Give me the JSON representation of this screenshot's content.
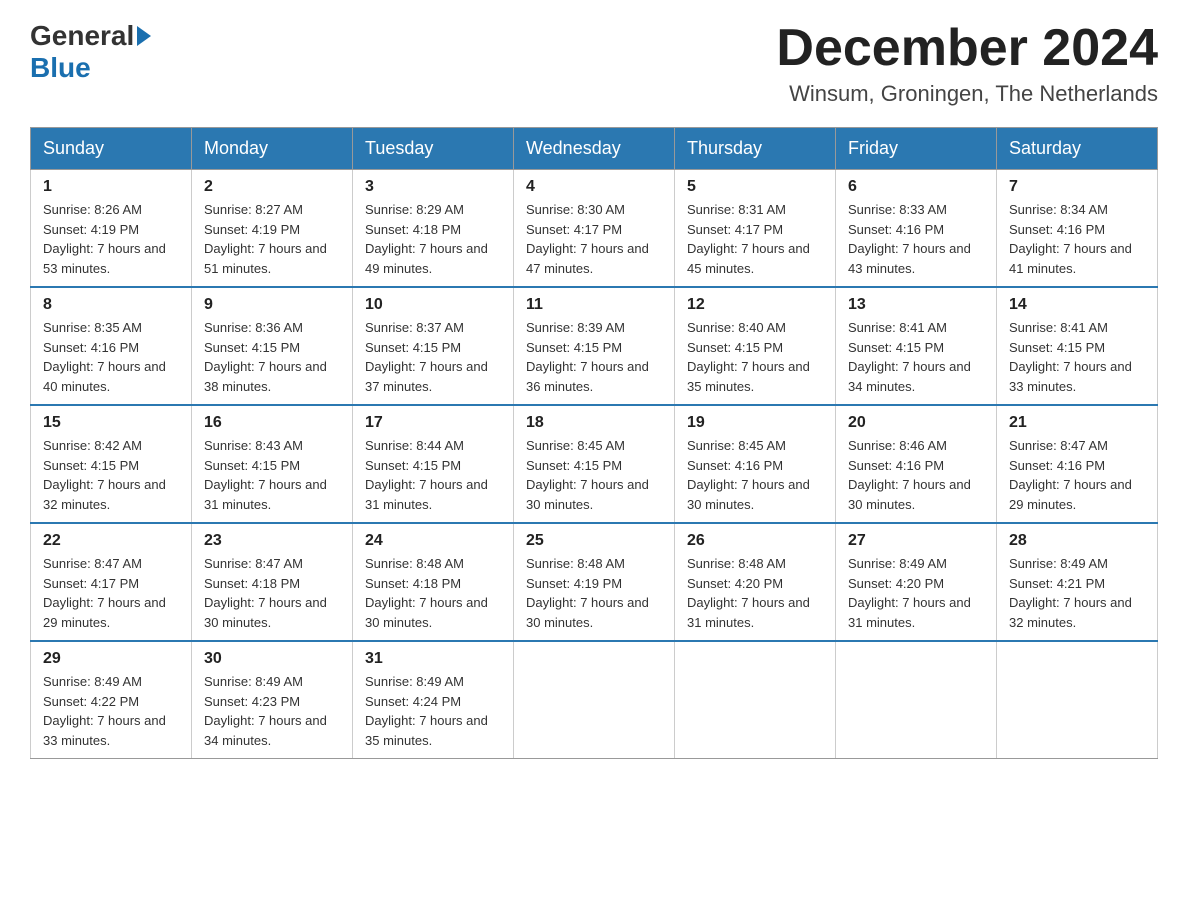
{
  "header": {
    "logo_general": "General",
    "logo_blue": "Blue",
    "month_title": "December 2024",
    "location": "Winsum, Groningen, The Netherlands"
  },
  "weekdays": [
    "Sunday",
    "Monday",
    "Tuesday",
    "Wednesday",
    "Thursday",
    "Friday",
    "Saturday"
  ],
  "weeks": [
    [
      {
        "day": "1",
        "sunrise": "8:26 AM",
        "sunset": "4:19 PM",
        "daylight": "7 hours and 53 minutes."
      },
      {
        "day": "2",
        "sunrise": "8:27 AM",
        "sunset": "4:19 PM",
        "daylight": "7 hours and 51 minutes."
      },
      {
        "day": "3",
        "sunrise": "8:29 AM",
        "sunset": "4:18 PM",
        "daylight": "7 hours and 49 minutes."
      },
      {
        "day": "4",
        "sunrise": "8:30 AM",
        "sunset": "4:17 PM",
        "daylight": "7 hours and 47 minutes."
      },
      {
        "day": "5",
        "sunrise": "8:31 AM",
        "sunset": "4:17 PM",
        "daylight": "7 hours and 45 minutes."
      },
      {
        "day": "6",
        "sunrise": "8:33 AM",
        "sunset": "4:16 PM",
        "daylight": "7 hours and 43 minutes."
      },
      {
        "day": "7",
        "sunrise": "8:34 AM",
        "sunset": "4:16 PM",
        "daylight": "7 hours and 41 minutes."
      }
    ],
    [
      {
        "day": "8",
        "sunrise": "8:35 AM",
        "sunset": "4:16 PM",
        "daylight": "7 hours and 40 minutes."
      },
      {
        "day": "9",
        "sunrise": "8:36 AM",
        "sunset": "4:15 PM",
        "daylight": "7 hours and 38 minutes."
      },
      {
        "day": "10",
        "sunrise": "8:37 AM",
        "sunset": "4:15 PM",
        "daylight": "7 hours and 37 minutes."
      },
      {
        "day": "11",
        "sunrise": "8:39 AM",
        "sunset": "4:15 PM",
        "daylight": "7 hours and 36 minutes."
      },
      {
        "day": "12",
        "sunrise": "8:40 AM",
        "sunset": "4:15 PM",
        "daylight": "7 hours and 35 minutes."
      },
      {
        "day": "13",
        "sunrise": "8:41 AM",
        "sunset": "4:15 PM",
        "daylight": "7 hours and 34 minutes."
      },
      {
        "day": "14",
        "sunrise": "8:41 AM",
        "sunset": "4:15 PM",
        "daylight": "7 hours and 33 minutes."
      }
    ],
    [
      {
        "day": "15",
        "sunrise": "8:42 AM",
        "sunset": "4:15 PM",
        "daylight": "7 hours and 32 minutes."
      },
      {
        "day": "16",
        "sunrise": "8:43 AM",
        "sunset": "4:15 PM",
        "daylight": "7 hours and 31 minutes."
      },
      {
        "day": "17",
        "sunrise": "8:44 AM",
        "sunset": "4:15 PM",
        "daylight": "7 hours and 31 minutes."
      },
      {
        "day": "18",
        "sunrise": "8:45 AM",
        "sunset": "4:15 PM",
        "daylight": "7 hours and 30 minutes."
      },
      {
        "day": "19",
        "sunrise": "8:45 AM",
        "sunset": "4:16 PM",
        "daylight": "7 hours and 30 minutes."
      },
      {
        "day": "20",
        "sunrise": "8:46 AM",
        "sunset": "4:16 PM",
        "daylight": "7 hours and 30 minutes."
      },
      {
        "day": "21",
        "sunrise": "8:47 AM",
        "sunset": "4:16 PM",
        "daylight": "7 hours and 29 minutes."
      }
    ],
    [
      {
        "day": "22",
        "sunrise": "8:47 AM",
        "sunset": "4:17 PM",
        "daylight": "7 hours and 29 minutes."
      },
      {
        "day": "23",
        "sunrise": "8:47 AM",
        "sunset": "4:18 PM",
        "daylight": "7 hours and 30 minutes."
      },
      {
        "day": "24",
        "sunrise": "8:48 AM",
        "sunset": "4:18 PM",
        "daylight": "7 hours and 30 minutes."
      },
      {
        "day": "25",
        "sunrise": "8:48 AM",
        "sunset": "4:19 PM",
        "daylight": "7 hours and 30 minutes."
      },
      {
        "day": "26",
        "sunrise": "8:48 AM",
        "sunset": "4:20 PM",
        "daylight": "7 hours and 31 minutes."
      },
      {
        "day": "27",
        "sunrise": "8:49 AM",
        "sunset": "4:20 PM",
        "daylight": "7 hours and 31 minutes."
      },
      {
        "day": "28",
        "sunrise": "8:49 AM",
        "sunset": "4:21 PM",
        "daylight": "7 hours and 32 minutes."
      }
    ],
    [
      {
        "day": "29",
        "sunrise": "8:49 AM",
        "sunset": "4:22 PM",
        "daylight": "7 hours and 33 minutes."
      },
      {
        "day": "30",
        "sunrise": "8:49 AM",
        "sunset": "4:23 PM",
        "daylight": "7 hours and 34 minutes."
      },
      {
        "day": "31",
        "sunrise": "8:49 AM",
        "sunset": "4:24 PM",
        "daylight": "7 hours and 35 minutes."
      },
      null,
      null,
      null,
      null
    ]
  ]
}
